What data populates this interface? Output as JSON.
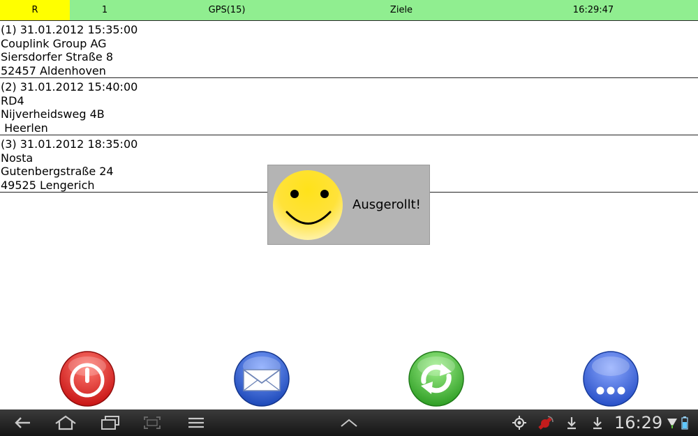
{
  "topbar": {
    "r": "R",
    "count": "1",
    "gps": "GPS(15)",
    "ziele": "Ziele",
    "time": "16:29:47",
    "colors": {
      "r_bg": "#ffff00",
      "bar_bg": "#90ee90"
    }
  },
  "entries": [
    {
      "header": "(1) 31.01.2012 15:35:00",
      "name": "Couplink Group AG",
      "street": "Siersdorfer Straße 8",
      "city": "52457 Aldenhoven"
    },
    {
      "header": "(2) 31.01.2012 15:40:00",
      "name": "RD4",
      "street": "Nijverheidsweg 4B",
      "city": " Heerlen"
    },
    {
      "header": "(3) 31.01.2012 18:35:00",
      "name": "Nosta",
      "street": "Gutenbergstraße 24",
      "city": "49525 Lengerich"
    }
  ],
  "toast": {
    "message": "Ausgerollt!",
    "icon": "smiley-icon"
  },
  "actions": [
    {
      "icon": "power-icon",
      "color": "#d9201f"
    },
    {
      "icon": "envelope-icon",
      "color": "#2a5bc8"
    },
    {
      "icon": "refresh-icon",
      "color": "#3aa82f"
    },
    {
      "icon": "more-icon",
      "color": "#3c64d6"
    }
  ],
  "system_bar": {
    "clock": "16:29",
    "icons": [
      "back-icon",
      "home-icon",
      "recent-apps-icon",
      "screenshot-icon",
      "menu-icon",
      "expand-icon",
      "gps-icon",
      "satellite-icon",
      "download-icon",
      "download-icon",
      "wifi-icon",
      "battery-icon"
    ]
  }
}
